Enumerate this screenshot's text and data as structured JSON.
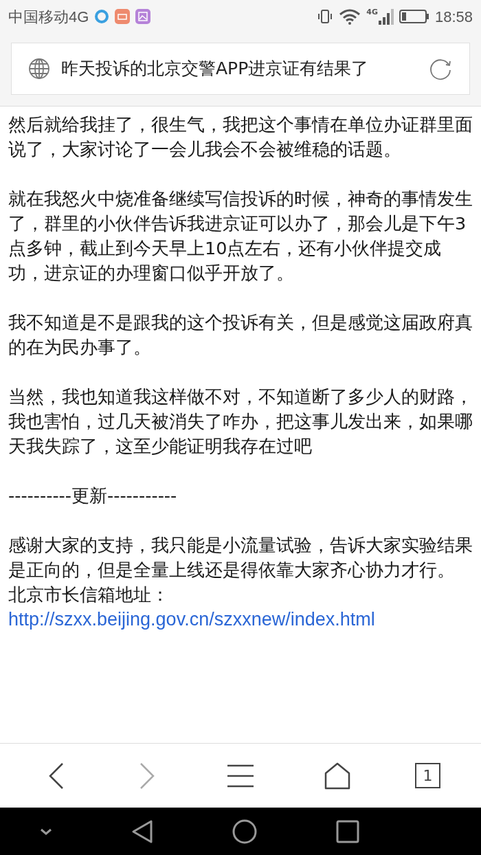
{
  "status_bar": {
    "carrier": "中国移动4G",
    "network": "4G",
    "time": "18:58"
  },
  "address_bar": {
    "title": "昨天投诉的北京交警APP进京证有结果了"
  },
  "article": [
    {
      "kind": "text",
      "text": "然后就给我挂了，很生气，我把这个事情在单位办证群里面说了，大家讨论了一会儿我会不会被维稳的话题。"
    },
    {
      "kind": "text",
      "text": "就在我怒火中烧准备继续写信投诉的时候，神奇的事情发生了，群里的小伙伴告诉我进京证可以办了，那会儿是下午3点多钟，截止到今天早上10点左右，还有小伙伴提交成功，进京证的办理窗口似乎开放了。"
    },
    {
      "kind": "text",
      "text": "我不知道是不是跟我的这个投诉有关，但是感觉这届政府真的在为民办事了。"
    },
    {
      "kind": "text",
      "text": "当然，我也知道我这样做不对，不知道断了多少人的财路，我也害怕，过几天被消失了咋办，把这事儿发出来，如果哪天我失踪了，这至少能证明我存在过吧"
    },
    {
      "kind": "text",
      "text": "----------更新-----------"
    },
    {
      "kind": "link",
      "text": "感谢大家的支持，我只能是小流量试验，告诉大家实验结果是正向的，但是全量上线还是得依靠大家齐心协力才行。",
      "label": "北京市长信箱地址：",
      "link": "http://szxx.beijing.gov.cn/szxxnew/index.html"
    }
  ],
  "toolbar": [
    {
      "kind": "back",
      "disabled": false
    },
    {
      "kind": "forward",
      "disabled": true
    },
    {
      "kind": "menu",
      "disabled": false
    },
    {
      "kind": "home",
      "disabled": false
    },
    {
      "kind": "tabs",
      "disabled": false,
      "count": "1"
    }
  ]
}
